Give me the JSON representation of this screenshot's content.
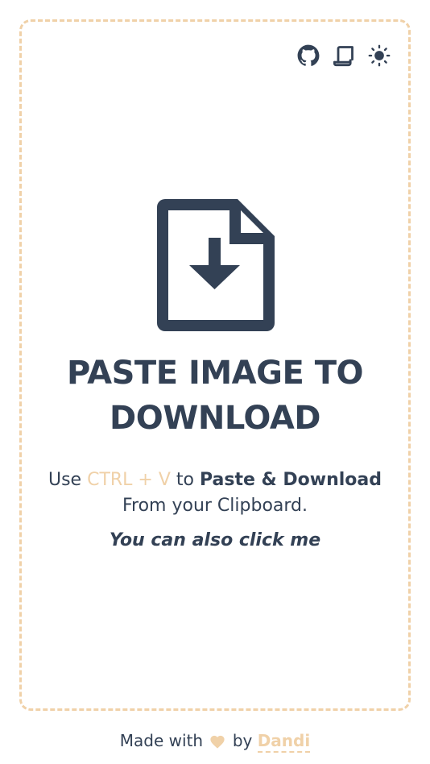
{
  "toolbar": {
    "github_icon": "github-icon",
    "readme_icon": "scroll-icon",
    "theme_icon": "sun-icon"
  },
  "dropzone": {
    "icon": "file-download-icon",
    "title_line1": "PASTE IMAGE TO",
    "title_line2": "DOWNLOAD",
    "instruction_prefix": "Use",
    "shortcut": "CTRL + V",
    "instruction_middle": "to",
    "instruction_action": "Paste & Download",
    "instruction_suffix": "From your Clipboard.",
    "click_hint": "You can also click me"
  },
  "footer": {
    "made_with": "Made with",
    "by": "by",
    "author": "Dandi"
  },
  "colors": {
    "accent": "#f0d1a8",
    "text": "#334155",
    "background": "#ffffff"
  }
}
